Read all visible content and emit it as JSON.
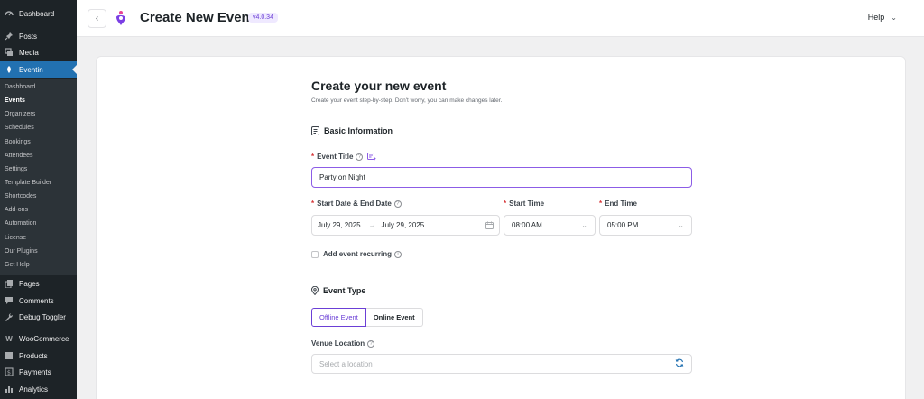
{
  "sidebar": {
    "top_items": [
      {
        "label": "Dashboard",
        "icon": "dashboard-icon"
      },
      {
        "label": "Posts",
        "icon": "pin-icon"
      },
      {
        "label": "Media",
        "icon": "media-icon"
      },
      {
        "label": "Eventin",
        "icon": "eventin-icon"
      }
    ],
    "submenu": [
      "Dashboard",
      "Events",
      "Organizers",
      "Schedules",
      "Bookings",
      "Attendees",
      "Settings",
      "Template Builder",
      "Shortcodes",
      "Add-ons",
      "Automation",
      "License",
      "Our Plugins",
      "Get Help"
    ],
    "bottom_items": [
      {
        "label": "Pages",
        "icon": "pages-icon"
      },
      {
        "label": "Comments",
        "icon": "comments-icon"
      },
      {
        "label": "Debug Toggler",
        "icon": "wrench-icon"
      },
      {
        "label": "WooCommerce",
        "icon": "woocommerce-icon"
      },
      {
        "label": "Products",
        "icon": "products-icon"
      },
      {
        "label": "Payments",
        "icon": "payments-icon"
      },
      {
        "label": "Analytics",
        "icon": "analytics-icon"
      }
    ]
  },
  "header": {
    "title": "Create New Event",
    "version": "v4.0.34",
    "help_label": "Help"
  },
  "form": {
    "heading": "Create your new event",
    "subheading": "Create your event step-by-step. Don't worry, you can make changes later.",
    "basic_info_title": "Basic Information",
    "event_title_label": "Event Title",
    "event_title_value": "Party on Night",
    "date_label": "Start Date & End Date",
    "start_date": "July 29, 2025",
    "end_date": "July 29, 2025",
    "start_time_label": "Start Time",
    "start_time": "08:00 AM",
    "end_time_label": "End Time",
    "end_time": "05:00 PM",
    "recurring_label": "Add event recurring",
    "event_type_title": "Event Type",
    "offline_tab": "Offline Event",
    "online_tab": "Online Event",
    "venue_label": "Venue Location",
    "venue_placeholder": "Select a location"
  },
  "colors": {
    "accent": "#6b3fd6",
    "wp_active": "#2271b1",
    "required": "#d63638"
  }
}
